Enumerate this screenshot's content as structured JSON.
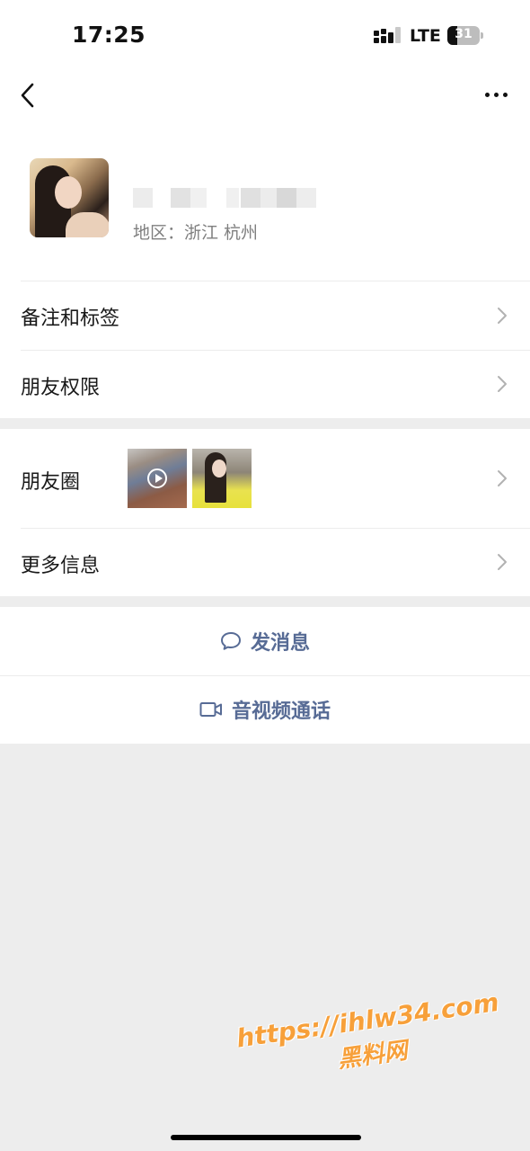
{
  "status_bar": {
    "time": "17:25",
    "network": "LTE",
    "battery_level": "31",
    "battery_percent": 31
  },
  "nav": {
    "back_icon": "chevron-left-icon",
    "more_icon": "more-horizontal-icon"
  },
  "profile": {
    "region": "地区：浙江 杭州"
  },
  "menu": {
    "remarks_tags": "备注和标签",
    "friend_permissions": "朋友权限",
    "moments": "朋友圈",
    "more_info": "更多信息"
  },
  "actions": {
    "send_message": "发消息",
    "video_call": "音视频通话"
  },
  "watermark": {
    "url": "https://ihlw34.com",
    "name": "黑料网"
  },
  "colors": {
    "accent": "#576b95",
    "background": "#ededed",
    "watermark": "#f7a03a"
  }
}
